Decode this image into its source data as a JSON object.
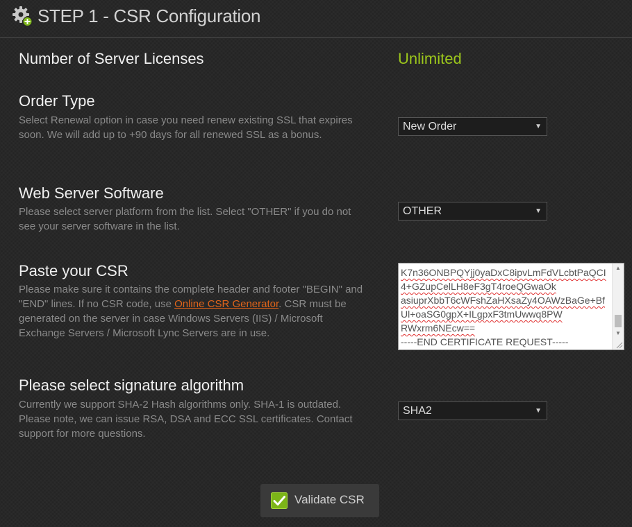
{
  "header": {
    "title": "STEP 1 - CSR Configuration",
    "icon": "gear-add-icon",
    "badge_color": "#7cb518"
  },
  "licenses": {
    "label": "Number of Server Licenses",
    "value": "Unlimited",
    "value_color": "#9dc81c"
  },
  "order_type": {
    "label": "Order Type",
    "description": "Select Renewal option in case you need renew existing SSL that expires soon. We will add up to +90 days for all renewed SSL as a bonus.",
    "selected": "New Order"
  },
  "web_server": {
    "label": "Web Server Software",
    "description": "Please select server platform from the list. Select \"OTHER\" if you do not see your server software in the list.",
    "selected": "OTHER"
  },
  "csr": {
    "label": "Paste your CSR",
    "description_before": "Please make sure it contains the complete header and footer \"BEGIN\" and \"END\" lines. If no CSR code, use ",
    "generator_link": "Online CSR Generator",
    "description_after": ". CSR must be generated on the server in case Windows Servers (IIS) / Microsoft Exchange Servers / Microsoft Lync Servers are in use.",
    "lines": [
      "K7n36ONBPQYjj0yaDxC8ipvLmFdVLcbtPaQCI",
      "4+GZupCelLH8eF3gT4roeQGwaOk",
      "asiuprXbbT6cWFshZaHXsaZy4OAWzBaGe+Bf",
      "Ul+oaSG0gpX+ILgpxF3tmUwwq8PW",
      "RWxrm6NEcw==",
      "-----END CERTIFICATE REQUEST-----"
    ]
  },
  "signature": {
    "label": "Please select signature algorithm",
    "description": "Currently we support SHA-2 Hash algorithms only. SHA-1 is outdated. Please note, we can issue RSA, DSA and ECC SSL certificates. Contact support for more questions.",
    "selected": "SHA2"
  },
  "validate_button": {
    "label": "Validate CSR",
    "icon": "checkmark-icon",
    "check_color": "#7cb518"
  }
}
